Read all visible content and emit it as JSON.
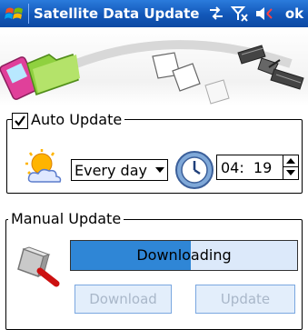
{
  "title_bar": {
    "title": "Satellite Data Update",
    "ok_label": "ok",
    "icons": [
      "windows-flag-icon",
      "connectivity-icon",
      "signal-off-icon",
      "volume-icon"
    ]
  },
  "auto_update": {
    "legend": "Auto Update",
    "checked": true,
    "frequency": "Every day",
    "time_hour": "04",
    "time_minute": "19",
    "time_display": "04:  19"
  },
  "manual_update": {
    "legend": "Manual Update",
    "progress_label": "Downloading",
    "progress_fraction": 0.53,
    "download_label": "Download",
    "update_label": "Update",
    "buttons_enabled": false
  },
  "colors": {
    "title_bar": "#1257b8",
    "progress_fill": "#2f86d6",
    "disabled_button": "#e3eefb"
  }
}
